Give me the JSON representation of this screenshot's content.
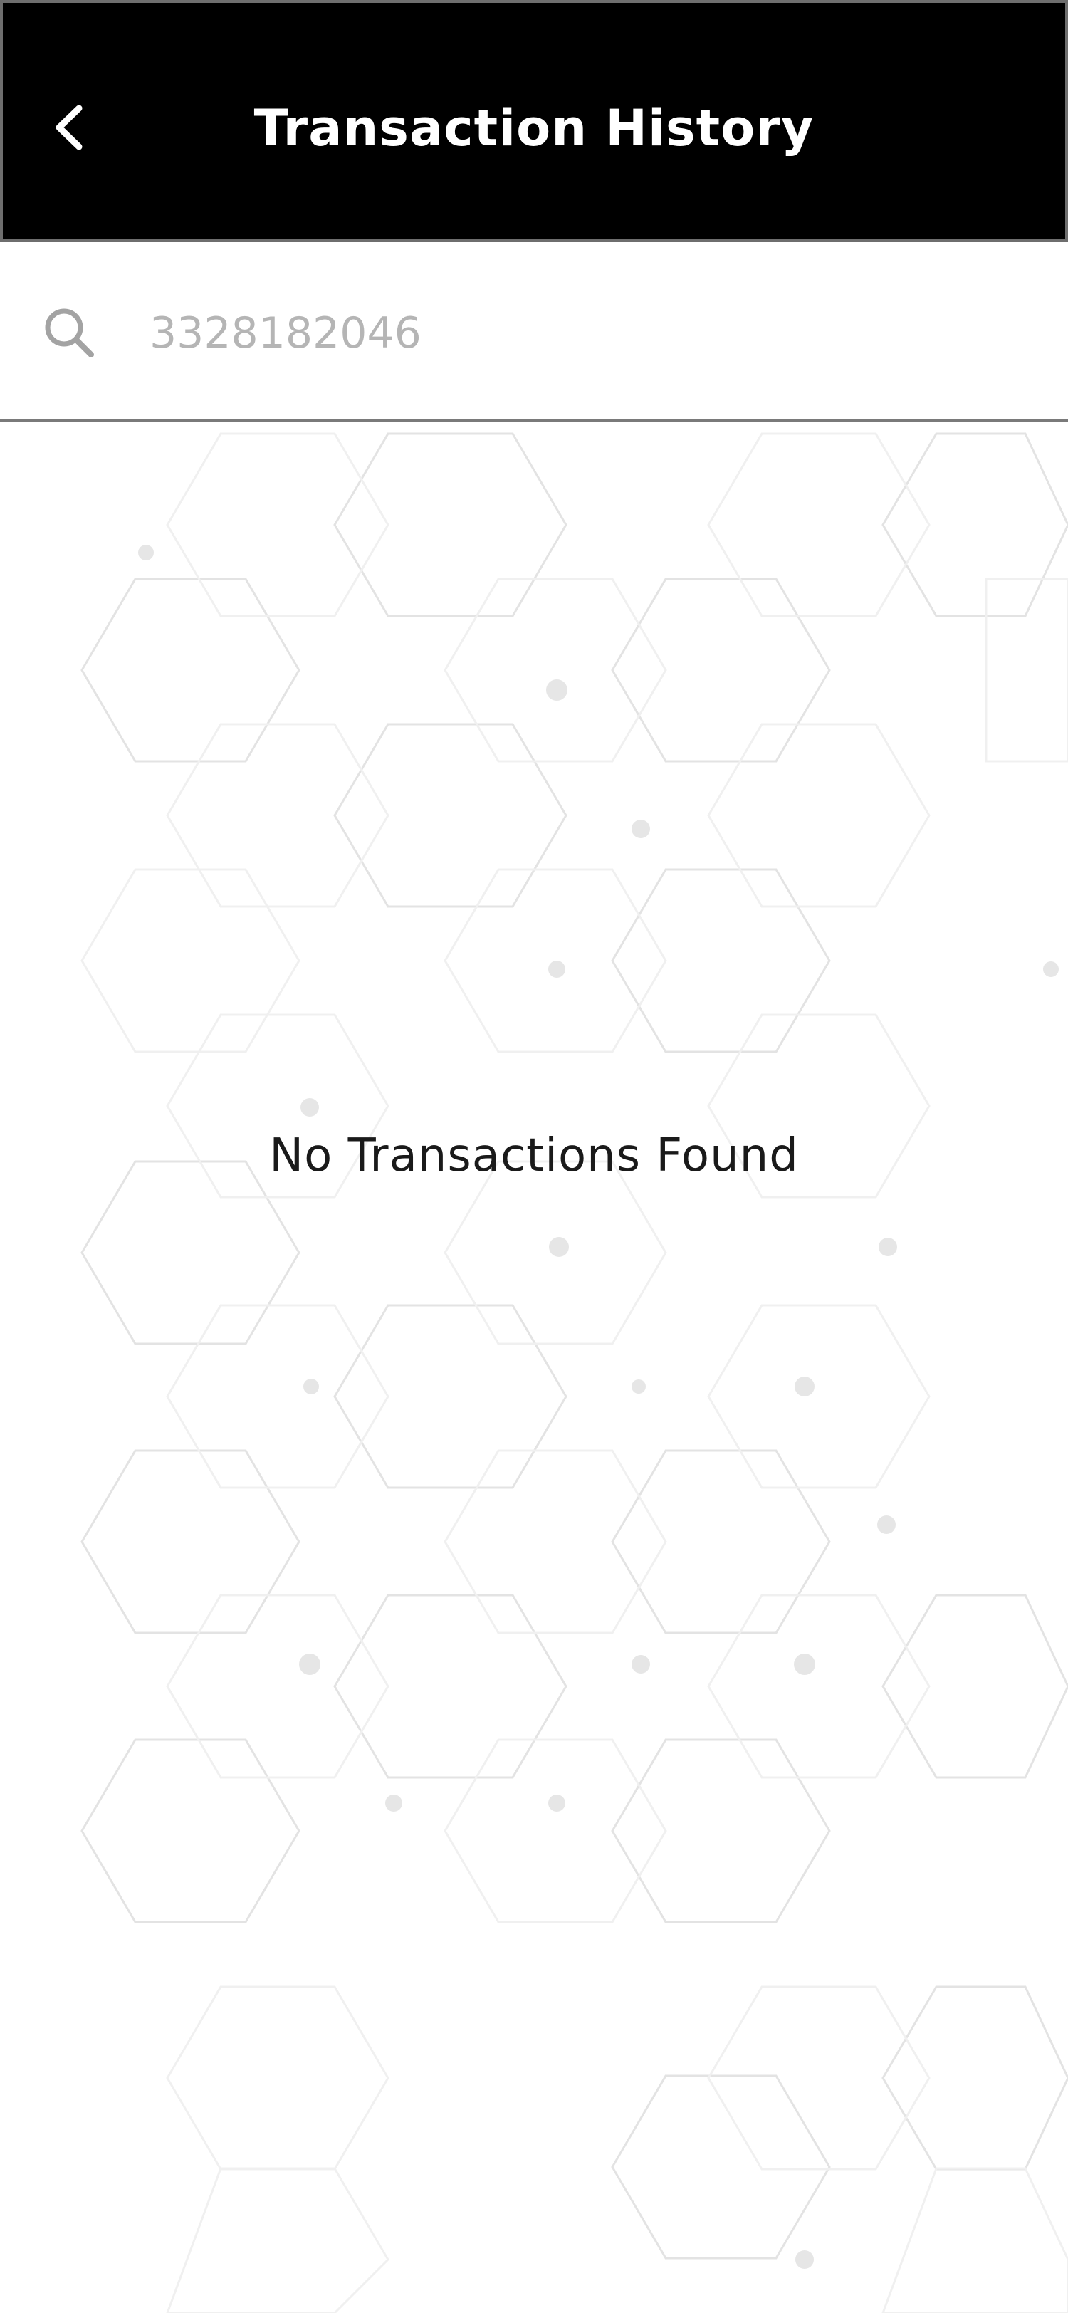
{
  "header": {
    "title": "Transaction History",
    "back_icon": "chevron-left-icon"
  },
  "search": {
    "icon": "search-icon",
    "placeholder": "3328182046"
  },
  "empty_state": {
    "message": "No Transactions Found"
  },
  "colors": {
    "header_bg": "#000000",
    "header_text": "#ffffff",
    "placeholder_text": "#b5b5b5",
    "body_text": "#1a1a1a",
    "pattern_stroke": "#e6e6e6"
  }
}
